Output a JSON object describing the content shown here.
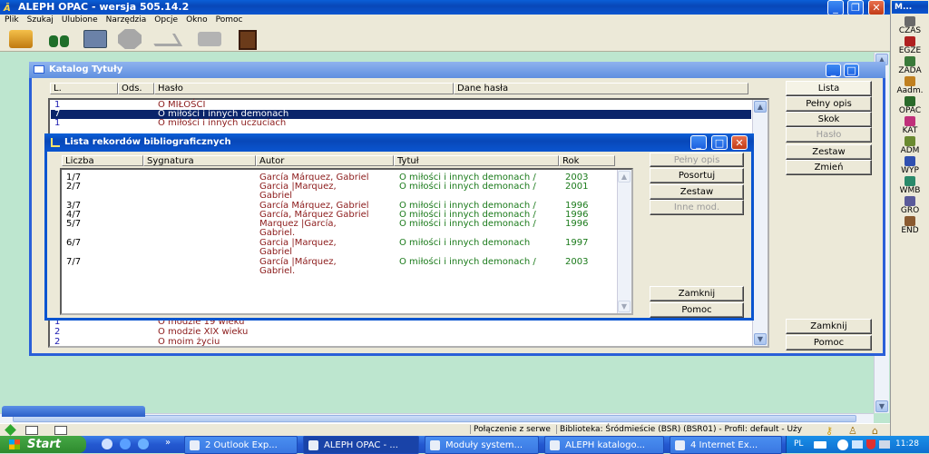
{
  "app": {
    "title": "ALEPH OPAC - wersja 505.14.2"
  },
  "menu": [
    "Plik",
    "Szukaj",
    "Ulubione",
    "Narzędzia",
    "Opcje",
    "Okno",
    "Pomoc"
  ],
  "toolbar_icons": [
    "printer-icon",
    "binoculars-icon",
    "card-icon",
    "octagon-icon",
    "arrow-icon",
    "print-icon",
    "exit-door-icon"
  ],
  "side_toolbar": {
    "title": "M...",
    "items": [
      {
        "label": "CZAS",
        "icon": "clock-icon",
        "color": "#6a6a6a"
      },
      {
        "label": "EGZE",
        "icon": "books-icon",
        "color": "#b02020"
      },
      {
        "label": "ZADA",
        "icon": "task-icon",
        "color": "#3a7a3a"
      },
      {
        "label": "Aadm.",
        "icon": "admin-icon",
        "color": "#c08020"
      },
      {
        "label": "OPAC",
        "icon": "binoculars-icon",
        "color": "#2a6a2a"
      },
      {
        "label": "KAT",
        "icon": "catalog-icon",
        "color": "#c0307a"
      },
      {
        "label": "ADM",
        "icon": "adm-icon",
        "color": "#6a8a30"
      },
      {
        "label": "WYP",
        "icon": "circulation-icon",
        "color": "#3050b0"
      },
      {
        "label": "WMB",
        "icon": "globe-icon",
        "color": "#2a8a6a"
      },
      {
        "label": "GRO",
        "icon": "group-icon",
        "color": "#5a5a9a"
      },
      {
        "label": "END",
        "icon": "end-icon",
        "color": "#8a5a30"
      }
    ]
  },
  "katalog": {
    "title": "Katalog Tytuły",
    "headers": [
      "L.",
      "Ods.",
      "Hasło",
      "Dane hasła"
    ],
    "rows_top": [
      {
        "n": "1",
        "text": "O MIŁOŚCI",
        "selected": false
      },
      {
        "n": "7",
        "text": "O miłości i innych demonach",
        "selected": true
      },
      {
        "n": "1",
        "text": "O miłości i innych uczuciach",
        "selected": false
      }
    ],
    "rows_bottom": [
      {
        "n": "1",
        "text": "O modzie 19 wieku"
      },
      {
        "n": "2",
        "text": "O modzie XIX wieku"
      },
      {
        "n": "2",
        "text": "O moim życiu"
      }
    ],
    "buttons": {
      "lista": "Lista",
      "pelny_opis": "Pełny opis",
      "skok": "Skok",
      "haslo": "Hasło",
      "zestaw": "Zestaw",
      "zmien": "Zmień",
      "zamknij": "Zamknij",
      "pomoc": "Pomoc"
    }
  },
  "lista": {
    "title": "Lista rekordów bibliograficznych",
    "headers": [
      "Liczba",
      "Sygnatura",
      "Autor",
      "Tytuł",
      "Rok"
    ],
    "records": [
      {
        "liczba": "1/7",
        "autor": [
          "García Márquez, Gabriel"
        ],
        "tytul": "O miłości i innych demonach /",
        "rok": "2003"
      },
      {
        "liczba": "2/7",
        "autor": [
          "Garcia |Marquez,",
          "Gabriel"
        ],
        "tytul": "O miłości i innych demonach /",
        "rok": "2001"
      },
      {
        "liczba": "3/7",
        "autor": [
          "García Márquez, Gabriel"
        ],
        "tytul": "O miłości i innych demonach /",
        "rok": "1996"
      },
      {
        "liczba": "4/7",
        "autor": [
          "García, Márquez Gabriel"
        ],
        "tytul": "O miłości i innych demonach /",
        "rok": "1996"
      },
      {
        "liczba": "5/7",
        "autor": [
          "Marquez |García,",
          "Gabriel."
        ],
        "tytul": "O miłości i innych demonach /",
        "rok": "1996"
      },
      {
        "liczba": "6/7",
        "autor": [
          "Garcia |Marquez,",
          "Gabriel"
        ],
        "tytul": "O miłości i innych demonach",
        "rok": "1997"
      },
      {
        "liczba": "7/7",
        "autor": [
          "García |Márquez,",
          "Gabriel."
        ],
        "tytul": "O miłości i innych demonach /",
        "rok": "2003"
      }
    ],
    "buttons": {
      "pelny_opis": "Pełny opis",
      "posortuj": "Posortuj",
      "zestaw": "Zestaw",
      "inne_mod": "Inne mod.",
      "zamknij": "Zamknij",
      "pomoc": "Pomoc"
    }
  },
  "statusbar": {
    "connection": "Połączenie z serwe",
    "library": "Biblioteka:  Śródmieście (BSR) (BSR01) - Profil: default - Uży"
  },
  "taskbar": {
    "start": "Start",
    "items": [
      "2 Outlook Exp...",
      "ALEPH OPAC - ...",
      "Moduły system...",
      "ALEPH katalogo...",
      "4 Internet Ex..."
    ],
    "lang": "PL",
    "time": "11:28"
  },
  "colors": {
    "author": "#8b1a1a",
    "title": "#1a7a1a",
    "number": "#1a1ab0",
    "selection": "#0a246a",
    "xp_blue": "#0a55d0",
    "desktop": "#bde6cf"
  }
}
